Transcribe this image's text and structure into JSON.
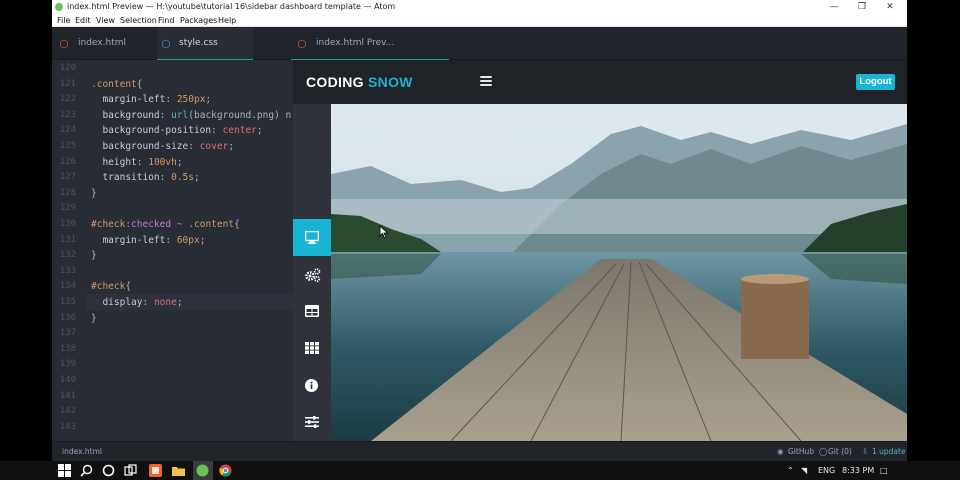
{
  "window": {
    "title": "index.html Preview — H:\\youtube\\tutorial 16\\sidebar dashboard template — Atom"
  },
  "menu": [
    "File",
    "Edit",
    "View",
    "Selection",
    "Find",
    "Packages",
    "Help"
  ],
  "tabs": [
    {
      "label": "index.html",
      "icon": "html5-icon",
      "active": false
    },
    {
      "label": "style.css",
      "icon": "css3-icon",
      "active": true
    },
    {
      "label": "index.html Prev...",
      "icon": "html5-icon",
      "active": false
    }
  ],
  "editor": {
    "line_numbers": [
      "120",
      "121",
      "122",
      "123",
      "124",
      "125",
      "126",
      "127",
      "128",
      "129",
      "130",
      "131",
      "132",
      "133",
      "134",
      "135",
      "136",
      "137",
      "138",
      "139",
      "140",
      "141",
      "142",
      "143"
    ],
    "lines": [
      "",
      ".content{",
      "  margin-left: 250px;",
      "  background: url(background.png) n",
      "  background-position: center;",
      "  background-size: cover;",
      "  height: 100vh;",
      "  transition: 0.5s;",
      "}",
      "",
      "#check:checked ~ .content{",
      "  margin-left: 60px;",
      "}",
      "",
      "#check{",
      "  display: none;",
      "}",
      "",
      "",
      "",
      "",
      "",
      "",
      ""
    ]
  },
  "preview": {
    "brand": {
      "main": "CODING",
      "accent": "SNOW"
    },
    "logout_label": "Logout",
    "accent_color": "#19b3d3",
    "sidebar_icons": [
      "desktop-icon",
      "cogs-icon",
      "table-icon",
      "th-icon",
      "info-icon",
      "sliders-icon"
    ],
    "active_sidebar_index": 0
  },
  "status": {
    "file": "index.html",
    "github": "GitHub",
    "git": "Git (0)",
    "update": "1 update"
  },
  "taskbar": {
    "lang": "ENG",
    "time": "8:33 PM"
  }
}
